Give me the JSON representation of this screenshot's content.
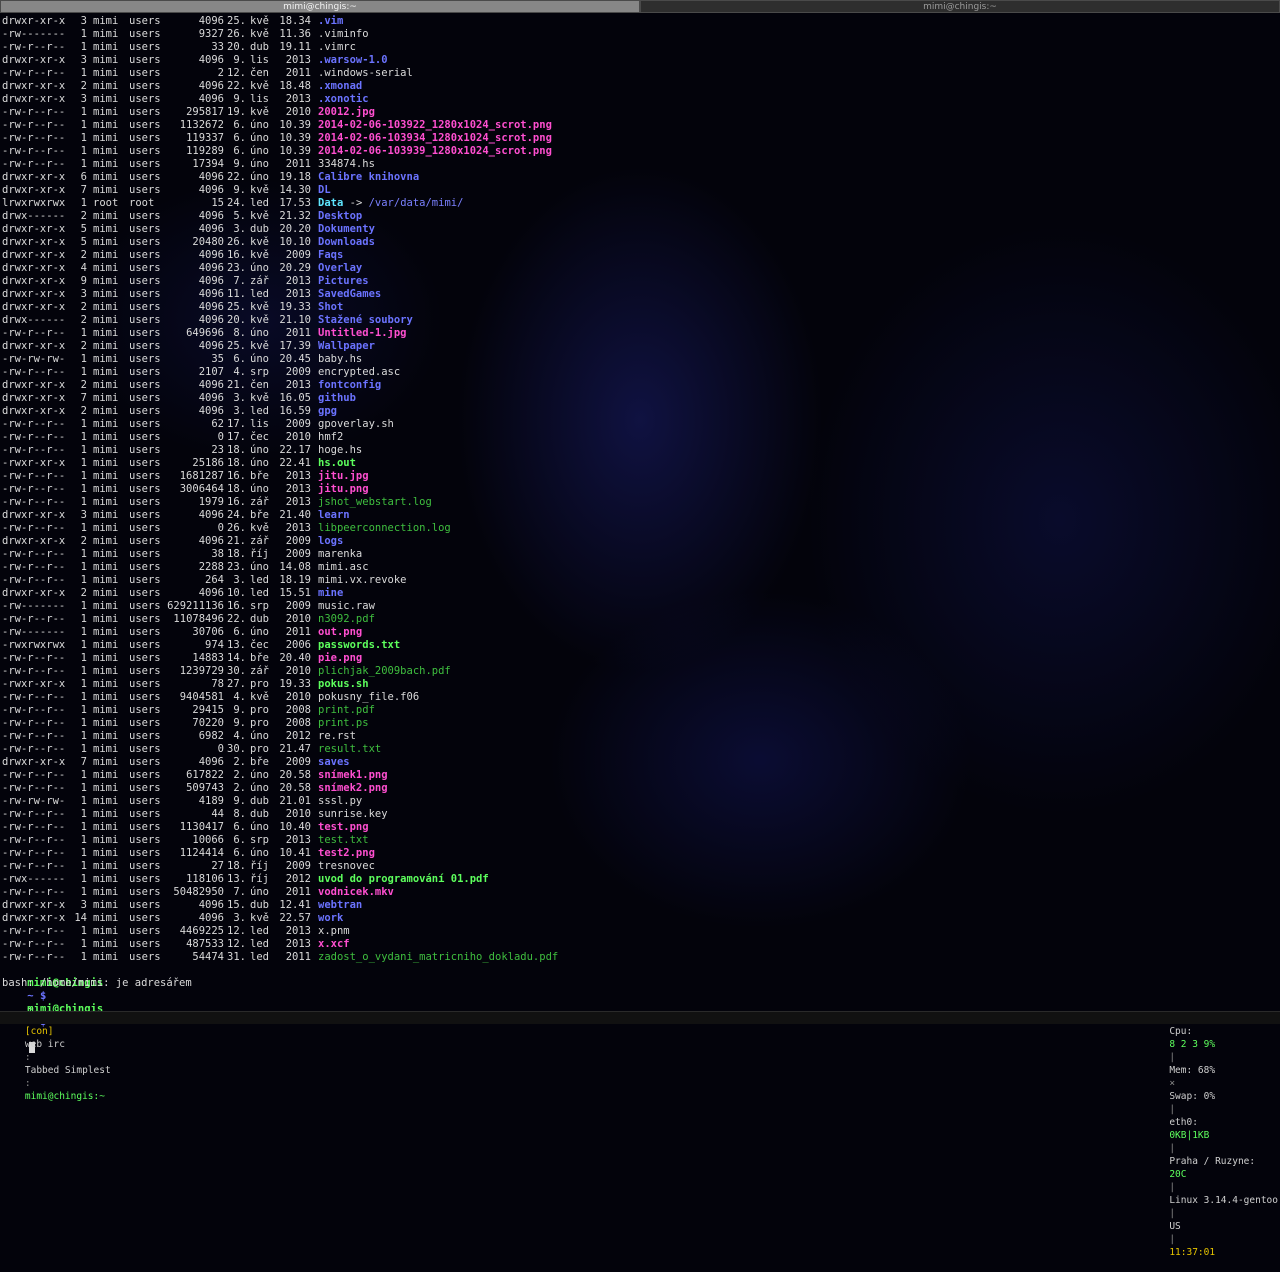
{
  "tabs": [
    {
      "title": "mimi@chingis:~",
      "active": true
    },
    {
      "title": "mimi@chingis:~",
      "active": false
    }
  ],
  "listing": [
    {
      "perm": "drwxr-xr-x",
      "links": "3",
      "owner": "mimi",
      "group": "users",
      "size": "4096",
      "day": "25.",
      "mon": "kvě",
      "time": "18.34",
      "name": ".vim",
      "type": "dir"
    },
    {
      "perm": "-rw-------",
      "links": "1",
      "owner": "mimi",
      "group": "users",
      "size": "9327",
      "day": "26.",
      "mon": "kvě",
      "time": "11.36",
      "name": ".viminfo",
      "type": "plain"
    },
    {
      "perm": "-rw-r--r--",
      "links": "1",
      "owner": "mimi",
      "group": "users",
      "size": "33",
      "day": "20.",
      "mon": "dub",
      "time": "19.11",
      "name": ".vimrc",
      "type": "plain"
    },
    {
      "perm": "drwxr-xr-x",
      "links": "3",
      "owner": "mimi",
      "group": "users",
      "size": "4096",
      "day": "9.",
      "mon": "lis",
      "time": "2013",
      "name": ".warsow-1.0",
      "type": "dir"
    },
    {
      "perm": "-rw-r--r--",
      "links": "1",
      "owner": "mimi",
      "group": "users",
      "size": "2",
      "day": "12.",
      "mon": "čen",
      "time": "2011",
      "name": ".windows-serial",
      "type": "plain"
    },
    {
      "perm": "drwxr-xr-x",
      "links": "2",
      "owner": "mimi",
      "group": "users",
      "size": "4096",
      "day": "22.",
      "mon": "kvě",
      "time": "18.48",
      "name": ".xmonad",
      "type": "dir"
    },
    {
      "perm": "drwxr-xr-x",
      "links": "3",
      "owner": "mimi",
      "group": "users",
      "size": "4096",
      "day": "9.",
      "mon": "lis",
      "time": "2013",
      "name": ".xonotic",
      "type": "dir"
    },
    {
      "perm": "-rw-r--r--",
      "links": "1",
      "owner": "mimi",
      "group": "users",
      "size": "295817",
      "day": "19.",
      "mon": "kvě",
      "time": "2010",
      "name": "20012.jpg",
      "type": "img"
    },
    {
      "perm": "-rw-r--r--",
      "links": "1",
      "owner": "mimi",
      "group": "users",
      "size": "1132672",
      "day": "6.",
      "mon": "úno",
      "time": "10.39",
      "name": "2014-02-06-103922_1280x1024_scrot.png",
      "type": "img"
    },
    {
      "perm": "-rw-r--r--",
      "links": "1",
      "owner": "mimi",
      "group": "users",
      "size": "119337",
      "day": "6.",
      "mon": "úno",
      "time": "10.39",
      "name": "2014-02-06-103934_1280x1024_scrot.png",
      "type": "img"
    },
    {
      "perm": "-rw-r--r--",
      "links": "1",
      "owner": "mimi",
      "group": "users",
      "size": "119289",
      "day": "6.",
      "mon": "úno",
      "time": "10.39",
      "name": "2014-02-06-103939_1280x1024_scrot.png",
      "type": "img"
    },
    {
      "perm": "-rw-r--r--",
      "links": "1",
      "owner": "mimi",
      "group": "users",
      "size": "17394",
      "day": "9.",
      "mon": "úno",
      "time": "2011",
      "name": "334874.hs",
      "type": "plain"
    },
    {
      "perm": "drwxr-xr-x",
      "links": "6",
      "owner": "mimi",
      "group": "users",
      "size": "4096",
      "day": "22.",
      "mon": "úno",
      "time": "19.18",
      "name": "Calibre knihovna",
      "type": "dir"
    },
    {
      "perm": "drwxr-xr-x",
      "links": "7",
      "owner": "mimi",
      "group": "users",
      "size": "4096",
      "day": "9.",
      "mon": "kvě",
      "time": "14.30",
      "name": "DL",
      "type": "dir"
    },
    {
      "perm": "lrwxrwxrwx",
      "links": "1",
      "owner": "root",
      "group": "root",
      "size": "15",
      "day": "24.",
      "mon": "led",
      "time": "17.53",
      "name": "Data",
      "type": "link",
      "target": "/var/data/mimi/"
    },
    {
      "perm": "drwx------",
      "links": "2",
      "owner": "mimi",
      "group": "users",
      "size": "4096",
      "day": "5.",
      "mon": "kvě",
      "time": "21.32",
      "name": "Desktop",
      "type": "dir"
    },
    {
      "perm": "drwxr-xr-x",
      "links": "5",
      "owner": "mimi",
      "group": "users",
      "size": "4096",
      "day": "3.",
      "mon": "dub",
      "time": "20.20",
      "name": "Dokumenty",
      "type": "dir"
    },
    {
      "perm": "drwxr-xr-x",
      "links": "5",
      "owner": "mimi",
      "group": "users",
      "size": "20480",
      "day": "26.",
      "mon": "kvě",
      "time": "10.10",
      "name": "Downloads",
      "type": "dir"
    },
    {
      "perm": "drwxr-xr-x",
      "links": "2",
      "owner": "mimi",
      "group": "users",
      "size": "4096",
      "day": "16.",
      "mon": "kvě",
      "time": "2009",
      "name": "Faqs",
      "type": "dir"
    },
    {
      "perm": "drwxr-xr-x",
      "links": "4",
      "owner": "mimi",
      "group": "users",
      "size": "4096",
      "day": "23.",
      "mon": "úno",
      "time": "20.29",
      "name": "Overlay",
      "type": "dir"
    },
    {
      "perm": "drwxr-xr-x",
      "links": "9",
      "owner": "mimi",
      "group": "users",
      "size": "4096",
      "day": "7.",
      "mon": "zář",
      "time": "2013",
      "name": "Pictures",
      "type": "dir"
    },
    {
      "perm": "drwxr-xr-x",
      "links": "3",
      "owner": "mimi",
      "group": "users",
      "size": "4096",
      "day": "11.",
      "mon": "led",
      "time": "2013",
      "name": "SavedGames",
      "type": "dir"
    },
    {
      "perm": "drwxr-xr-x",
      "links": "2",
      "owner": "mimi",
      "group": "users",
      "size": "4096",
      "day": "25.",
      "mon": "kvě",
      "time": "19.33",
      "name": "Shot",
      "type": "dir"
    },
    {
      "perm": "drwx------",
      "links": "2",
      "owner": "mimi",
      "group": "users",
      "size": "4096",
      "day": "20.",
      "mon": "kvě",
      "time": "21.10",
      "name": "Stažené soubory",
      "type": "dir"
    },
    {
      "perm": "-rw-r--r--",
      "links": "1",
      "owner": "mimi",
      "group": "users",
      "size": "649696",
      "day": "8.",
      "mon": "úno",
      "time": "2011",
      "name": "Untitled-1.jpg",
      "type": "img"
    },
    {
      "perm": "drwxr-xr-x",
      "links": "2",
      "owner": "mimi",
      "group": "users",
      "size": "4096",
      "day": "25.",
      "mon": "kvě",
      "time": "17.39",
      "name": "Wallpaper",
      "type": "dir"
    },
    {
      "perm": "-rw-rw-rw-",
      "links": "1",
      "owner": "mimi",
      "group": "users",
      "size": "35",
      "day": "6.",
      "mon": "úno",
      "time": "20.45",
      "name": "baby.hs",
      "type": "plain"
    },
    {
      "perm": "-rw-r--r--",
      "links": "1",
      "owner": "mimi",
      "group": "users",
      "size": "2107",
      "day": "4.",
      "mon": "srp",
      "time": "2009",
      "name": "encrypted.asc",
      "type": "plain"
    },
    {
      "perm": "drwxr-xr-x",
      "links": "2",
      "owner": "mimi",
      "group": "users",
      "size": "4096",
      "day": "21.",
      "mon": "čen",
      "time": "2013",
      "name": "fontconfig",
      "type": "dir"
    },
    {
      "perm": "drwxr-xr-x",
      "links": "7",
      "owner": "mimi",
      "group": "users",
      "size": "4096",
      "day": "3.",
      "mon": "kvě",
      "time": "16.05",
      "name": "github",
      "type": "dir"
    },
    {
      "perm": "drwxr-xr-x",
      "links": "2",
      "owner": "mimi",
      "group": "users",
      "size": "4096",
      "day": "3.",
      "mon": "led",
      "time": "16.59",
      "name": "gpg",
      "type": "dir"
    },
    {
      "perm": "-rw-r--r--",
      "links": "1",
      "owner": "mimi",
      "group": "users",
      "size": "62",
      "day": "17.",
      "mon": "lis",
      "time": "2009",
      "name": "gpoverlay.sh",
      "type": "plain"
    },
    {
      "perm": "-rw-r--r--",
      "links": "1",
      "owner": "mimi",
      "group": "users",
      "size": "0",
      "day": "17.",
      "mon": "čec",
      "time": "2010",
      "name": "hmf2",
      "type": "plain"
    },
    {
      "perm": "-rw-r--r--",
      "links": "1",
      "owner": "mimi",
      "group": "users",
      "size": "23",
      "day": "18.",
      "mon": "úno",
      "time": "22.17",
      "name": "hoge.hs",
      "type": "plain"
    },
    {
      "perm": "-rwxr-xr-x",
      "links": "1",
      "owner": "mimi",
      "group": "users",
      "size": "25186",
      "day": "18.",
      "mon": "úno",
      "time": "22.41",
      "name": "hs.out",
      "type": "exec"
    },
    {
      "perm": "-rw-r--r--",
      "links": "1",
      "owner": "mimi",
      "group": "users",
      "size": "1681287",
      "day": "16.",
      "mon": "bře",
      "time": "2013",
      "name": "jitu.jpg",
      "type": "img"
    },
    {
      "perm": "-rw-r--r--",
      "links": "1",
      "owner": "mimi",
      "group": "users",
      "size": "3006464",
      "day": "18.",
      "mon": "úno",
      "time": "2013",
      "name": "jitu.png",
      "type": "img"
    },
    {
      "perm": "-rw-r--r--",
      "links": "1",
      "owner": "mimi",
      "group": "users",
      "size": "1979",
      "day": "16.",
      "mon": "zář",
      "time": "2013",
      "name": "jshot_webstart.log",
      "type": "doc"
    },
    {
      "perm": "drwxr-xr-x",
      "links": "3",
      "owner": "mimi",
      "group": "users",
      "size": "4096",
      "day": "24.",
      "mon": "bře",
      "time": "21.40",
      "name": "learn",
      "type": "dir"
    },
    {
      "perm": "-rw-r--r--",
      "links": "1",
      "owner": "mimi",
      "group": "users",
      "size": "0",
      "day": "26.",
      "mon": "kvě",
      "time": "2013",
      "name": "libpeerconnection.log",
      "type": "doc"
    },
    {
      "perm": "drwxr-xr-x",
      "links": "2",
      "owner": "mimi",
      "group": "users",
      "size": "4096",
      "day": "21.",
      "mon": "zář",
      "time": "2009",
      "name": "logs",
      "type": "dir"
    },
    {
      "perm": "-rw-r--r--",
      "links": "1",
      "owner": "mimi",
      "group": "users",
      "size": "38",
      "day": "18.",
      "mon": "říj",
      "time": "2009",
      "name": "marenka",
      "type": "plain"
    },
    {
      "perm": "-rw-r--r--",
      "links": "1",
      "owner": "mimi",
      "group": "users",
      "size": "2288",
      "day": "23.",
      "mon": "úno",
      "time": "14.08",
      "name": "mimi.asc",
      "type": "plain"
    },
    {
      "perm": "-rw-r--r--",
      "links": "1",
      "owner": "mimi",
      "group": "users",
      "size": "264",
      "day": "3.",
      "mon": "led",
      "time": "18.19",
      "name": "mimi.vx.revoke",
      "type": "plain"
    },
    {
      "perm": "drwxr-xr-x",
      "links": "2",
      "owner": "mimi",
      "group": "users",
      "size": "4096",
      "day": "10.",
      "mon": "led",
      "time": "15.51",
      "name": "mine",
      "type": "dir"
    },
    {
      "perm": "-rw-------",
      "links": "1",
      "owner": "mimi",
      "group": "users",
      "size": "629211136",
      "day": "16.",
      "mon": "srp",
      "time": "2009",
      "name": "music.raw",
      "type": "plain"
    },
    {
      "perm": "-rw-r--r--",
      "links": "1",
      "owner": "mimi",
      "group": "users",
      "size": "11078496",
      "day": "22.",
      "mon": "dub",
      "time": "2010",
      "name": "n3092.pdf",
      "type": "doc"
    },
    {
      "perm": "-rw-------",
      "links": "1",
      "owner": "mimi",
      "group": "users",
      "size": "30706",
      "day": "6.",
      "mon": "úno",
      "time": "2011",
      "name": "out.png",
      "type": "img"
    },
    {
      "perm": "-rwxrwxrwx",
      "links": "1",
      "owner": "mimi",
      "group": "users",
      "size": "974",
      "day": "13.",
      "mon": "čec",
      "time": "2006",
      "name": "passwords.txt",
      "type": "exec"
    },
    {
      "perm": "-rw-r--r--",
      "links": "1",
      "owner": "mimi",
      "group": "users",
      "size": "14883",
      "day": "14.",
      "mon": "bře",
      "time": "20.40",
      "name": "pie.png",
      "type": "img"
    },
    {
      "perm": "-rw-r--r--",
      "links": "1",
      "owner": "mimi",
      "group": "users",
      "size": "1239729",
      "day": "30.",
      "mon": "zář",
      "time": "2010",
      "name": "plichjak_2009bach.pdf",
      "type": "doc"
    },
    {
      "perm": "-rwxr-xr-x",
      "links": "1",
      "owner": "mimi",
      "group": "users",
      "size": "78",
      "day": "27.",
      "mon": "pro",
      "time": "19.33",
      "name": "pokus.sh",
      "type": "exec"
    },
    {
      "perm": "-rw-r--r--",
      "links": "1",
      "owner": "mimi",
      "group": "users",
      "size": "9404581",
      "day": "4.",
      "mon": "kvě",
      "time": "2010",
      "name": "pokusny_file.f06",
      "type": "plain"
    },
    {
      "perm": "-rw-r--r--",
      "links": "1",
      "owner": "mimi",
      "group": "users",
      "size": "29415",
      "day": "9.",
      "mon": "pro",
      "time": "2008",
      "name": "print.pdf",
      "type": "doc"
    },
    {
      "perm": "-rw-r--r--",
      "links": "1",
      "owner": "mimi",
      "group": "users",
      "size": "70220",
      "day": "9.",
      "mon": "pro",
      "time": "2008",
      "name": "print.ps",
      "type": "doc"
    },
    {
      "perm": "-rw-r--r--",
      "links": "1",
      "owner": "mimi",
      "group": "users",
      "size": "6982",
      "day": "4.",
      "mon": "úno",
      "time": "2012",
      "name": "re.rst",
      "type": "plain"
    },
    {
      "perm": "-rw-r--r--",
      "links": "1",
      "owner": "mimi",
      "group": "users",
      "size": "0",
      "day": "30.",
      "mon": "pro",
      "time": "21.47",
      "name": "result.txt",
      "type": "doc"
    },
    {
      "perm": "drwxr-xr-x",
      "links": "7",
      "owner": "mimi",
      "group": "users",
      "size": "4096",
      "day": "2.",
      "mon": "bře",
      "time": "2009",
      "name": "saves",
      "type": "dir"
    },
    {
      "perm": "-rw-r--r--",
      "links": "1",
      "owner": "mimi",
      "group": "users",
      "size": "617822",
      "day": "2.",
      "mon": "úno",
      "time": "20.58",
      "name": "snímek1.png",
      "type": "img"
    },
    {
      "perm": "-rw-r--r--",
      "links": "1",
      "owner": "mimi",
      "group": "users",
      "size": "509743",
      "day": "2.",
      "mon": "úno",
      "time": "20.58",
      "name": "snímek2.png",
      "type": "img"
    },
    {
      "perm": "-rw-rw-rw-",
      "links": "1",
      "owner": "mimi",
      "group": "users",
      "size": "4189",
      "day": "9.",
      "mon": "dub",
      "time": "21.01",
      "name": "sssl.py",
      "type": "plain"
    },
    {
      "perm": "-rw-r--r--",
      "links": "1",
      "owner": "mimi",
      "group": "users",
      "size": "44",
      "day": "8.",
      "mon": "dub",
      "time": "2010",
      "name": "sunrise.key",
      "type": "plain"
    },
    {
      "perm": "-rw-r--r--",
      "links": "1",
      "owner": "mimi",
      "group": "users",
      "size": "1130417",
      "day": "6.",
      "mon": "úno",
      "time": "10.40",
      "name": "test.png",
      "type": "img"
    },
    {
      "perm": "-rw-r--r--",
      "links": "1",
      "owner": "mimi",
      "group": "users",
      "size": "10066",
      "day": "6.",
      "mon": "srp",
      "time": "2013",
      "name": "test.txt",
      "type": "doc"
    },
    {
      "perm": "-rw-r--r--",
      "links": "1",
      "owner": "mimi",
      "group": "users",
      "size": "1124414",
      "day": "6.",
      "mon": "úno",
      "time": "10.41",
      "name": "test2.png",
      "type": "img"
    },
    {
      "perm": "-rw-r--r--",
      "links": "1",
      "owner": "mimi",
      "group": "users",
      "size": "27",
      "day": "18.",
      "mon": "říj",
      "time": "2009",
      "name": "tresnovec",
      "type": "plain"
    },
    {
      "perm": "-rwx------",
      "links": "1",
      "owner": "mimi",
      "group": "users",
      "size": "118106",
      "day": "13.",
      "mon": "říj",
      "time": "2012",
      "name": "uvod do programování 01.pdf",
      "type": "exec"
    },
    {
      "perm": "-rw-r--r--",
      "links": "1",
      "owner": "mimi",
      "group": "users",
      "size": "50482950",
      "day": "7.",
      "mon": "úno",
      "time": "2011",
      "name": "vodnicek.mkv",
      "type": "img"
    },
    {
      "perm": "drwxr-xr-x",
      "links": "3",
      "owner": "mimi",
      "group": "users",
      "size": "4096",
      "day": "15.",
      "mon": "dub",
      "time": "12.41",
      "name": "webtran",
      "type": "dir"
    },
    {
      "perm": "drwxr-xr-x",
      "links": "14",
      "owner": "mimi",
      "group": "users",
      "size": "4096",
      "day": "3.",
      "mon": "kvě",
      "time": "22.57",
      "name": "work",
      "type": "dir"
    },
    {
      "perm": "-rw-r--r--",
      "links": "1",
      "owner": "mimi",
      "group": "users",
      "size": "4469225",
      "day": "12.",
      "mon": "led",
      "time": "2013",
      "name": "x.pnm",
      "type": "plain"
    },
    {
      "perm": "-rw-r--r--",
      "links": "1",
      "owner": "mimi",
      "group": "users",
      "size": "487533",
      "day": "12.",
      "mon": "led",
      "time": "2013",
      "name": "x.xcf",
      "type": "img"
    },
    {
      "perm": "-rw-r--r--",
      "links": "1",
      "owner": "mimi",
      "group": "users",
      "size": "54474",
      "day": "31.",
      "mon": "led",
      "time": "2011",
      "name": "zadost_o_vydani_matricniho_dokladu.pdf",
      "type": "doc"
    }
  ],
  "prompt1": {
    "user": "mimi@chingis",
    "path": "~ $",
    "cmd": "~"
  },
  "error_line": "bash: /home/mimi: je adresářem",
  "prompt2": {
    "user": "mimi@chingis",
    "path": "~ $",
    "cmd": ""
  },
  "status": {
    "left": {
      "workspace": "[con]",
      "apps": "web irc",
      "layout": "Tabbed Simplest",
      "window_title": "mimi@chingis:~"
    },
    "right": {
      "cpu_label": "Cpu:",
      "cpu_values": "8 2 3 9%",
      "mem": "Mem: 68%",
      "swap": "Swap: 0%",
      "net_label": "eth0:",
      "net_value": "0KB|1KB",
      "weather_label": "Praha / Ruzyne:",
      "weather_temp": "20C",
      "kernel": "Linux 3.14.4-gentoo",
      "layout_kb": "US",
      "clock": "11:37:01"
    }
  },
  "colors": {
    "dir": "#6b73ff",
    "image": "#ff4fd0",
    "exec": "#5dff5d",
    "doc": "#3fbf3f",
    "plain": "#dadada",
    "link": "#5fe6ff",
    "workspace": "#e6c400",
    "background": "#03030b"
  }
}
